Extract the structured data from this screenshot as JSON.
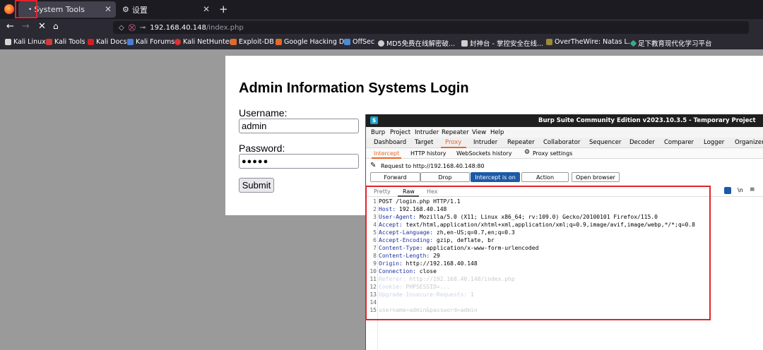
{
  "browser": {
    "tabs": [
      {
        "label": "System Tools",
        "active": true
      },
      {
        "label": "设置",
        "active": false
      }
    ],
    "new_tab_symbol": "+",
    "url": "192.168.40.148/index.php",
    "url_host": "192.168.40.148",
    "url_path": "/index.php",
    "bookmarks": [
      {
        "label": "Kali Linux",
        "color": "#d6d6d6"
      },
      {
        "label": "Kali Tools",
        "color": "#d03a3a"
      },
      {
        "label": "Kali Docs",
        "color": "#cc2222"
      },
      {
        "label": "Kali Forums",
        "color": "#4a7fd6"
      },
      {
        "label": "Kali NetHunter",
        "color": "#e03030"
      },
      {
        "label": "Exploit-DB",
        "color": "#e06a2a"
      },
      {
        "label": "Google Hacking DB",
        "color": "#e06a2a"
      },
      {
        "label": "OffSec",
        "color": "#4a8ad6"
      },
      {
        "label": "MD5免费在线解密破...",
        "color": "#cfcfcf"
      },
      {
        "label": "封神台 - 掌控安全在线...",
        "color": "#cfcfcf"
      },
      {
        "label": "OverTheWire: Natas L...",
        "color": "#9a8a3a"
      },
      {
        "label": "足下教育现代化学习平台",
        "color": "#3aaa8a"
      }
    ]
  },
  "login_page": {
    "title": "Admin Information Systems Login",
    "username_label": "Username:",
    "username_value": "admin",
    "password_label": "Password:",
    "password_value": "●●●●●",
    "submit_label": "Submit"
  },
  "burp": {
    "window_title": "Burp Suite Community Edition v2023.10.3.5 - Temporary Project",
    "menu": [
      "Burp",
      "Project",
      "Intruder",
      "Repeater",
      "View",
      "Help"
    ],
    "tabs": [
      "Dashboard",
      "Target",
      "Proxy",
      "Intruder",
      "Repeater",
      "Collaborator",
      "Sequencer",
      "Decoder",
      "Comparer",
      "Logger",
      "Organizer"
    ],
    "active_tab": "Proxy",
    "proxy_subtabs": [
      "Intercept",
      "HTTP history",
      "WebSockets history",
      "Proxy settings"
    ],
    "active_subtab": "Intercept",
    "request_to": "Request to http://192.168.40.148:80",
    "buttons": {
      "forward": "Forward",
      "drop": "Drop",
      "intercept": "Intercept is on",
      "action": "Action",
      "open_browser": "Open browser"
    },
    "editor_tabs": [
      "Pretty",
      "Raw",
      "Hex"
    ],
    "active_editor_tab": "Raw",
    "request_lines": [
      {
        "n": "1",
        "name": "",
        "value": "POST /login.php HTTP/1.1"
      },
      {
        "n": "2",
        "name": "Host:",
        "value": " 192.168.40.148"
      },
      {
        "n": "3",
        "name": "User-Agent:",
        "value": " Mozilla/5.0 (X11; Linux x86_64; rv:109.0) Gecko/20100101 Firefox/115.0"
      },
      {
        "n": "4",
        "name": "Accept:",
        "value": " text/html,application/xhtml+xml,application/xml;q=0.9,image/avif,image/webp,*/*;q=0.8"
      },
      {
        "n": "5",
        "name": "Accept-Language:",
        "value": " zh,en-US;q=0.7,en;q=0.3"
      },
      {
        "n": "6",
        "name": "Accept-Encoding:",
        "value": " gzip, deflate, br"
      },
      {
        "n": "7",
        "name": "Content-Type:",
        "value": " application/x-www-form-urlencoded"
      },
      {
        "n": "8",
        "name": "Content-Length:",
        "value": " 29"
      },
      {
        "n": "9",
        "name": "Origin:",
        "value": " http://192.168.40.148"
      },
      {
        "n": "10",
        "name": "Connection:",
        "value": " close"
      },
      {
        "n": "11",
        "name": "Referer:",
        "value": " http://192.168.40.148/index.php"
      },
      {
        "n": "12",
        "name": "Cookie:",
        "value": " PHPSESSID=..."
      },
      {
        "n": "13",
        "name": "Upgrade-Insecure-Requests:",
        "value": " 1"
      },
      {
        "n": "14",
        "name": "",
        "value": ""
      },
      {
        "n": "15",
        "name": "",
        "value": "username=admin&password=admin"
      }
    ]
  }
}
